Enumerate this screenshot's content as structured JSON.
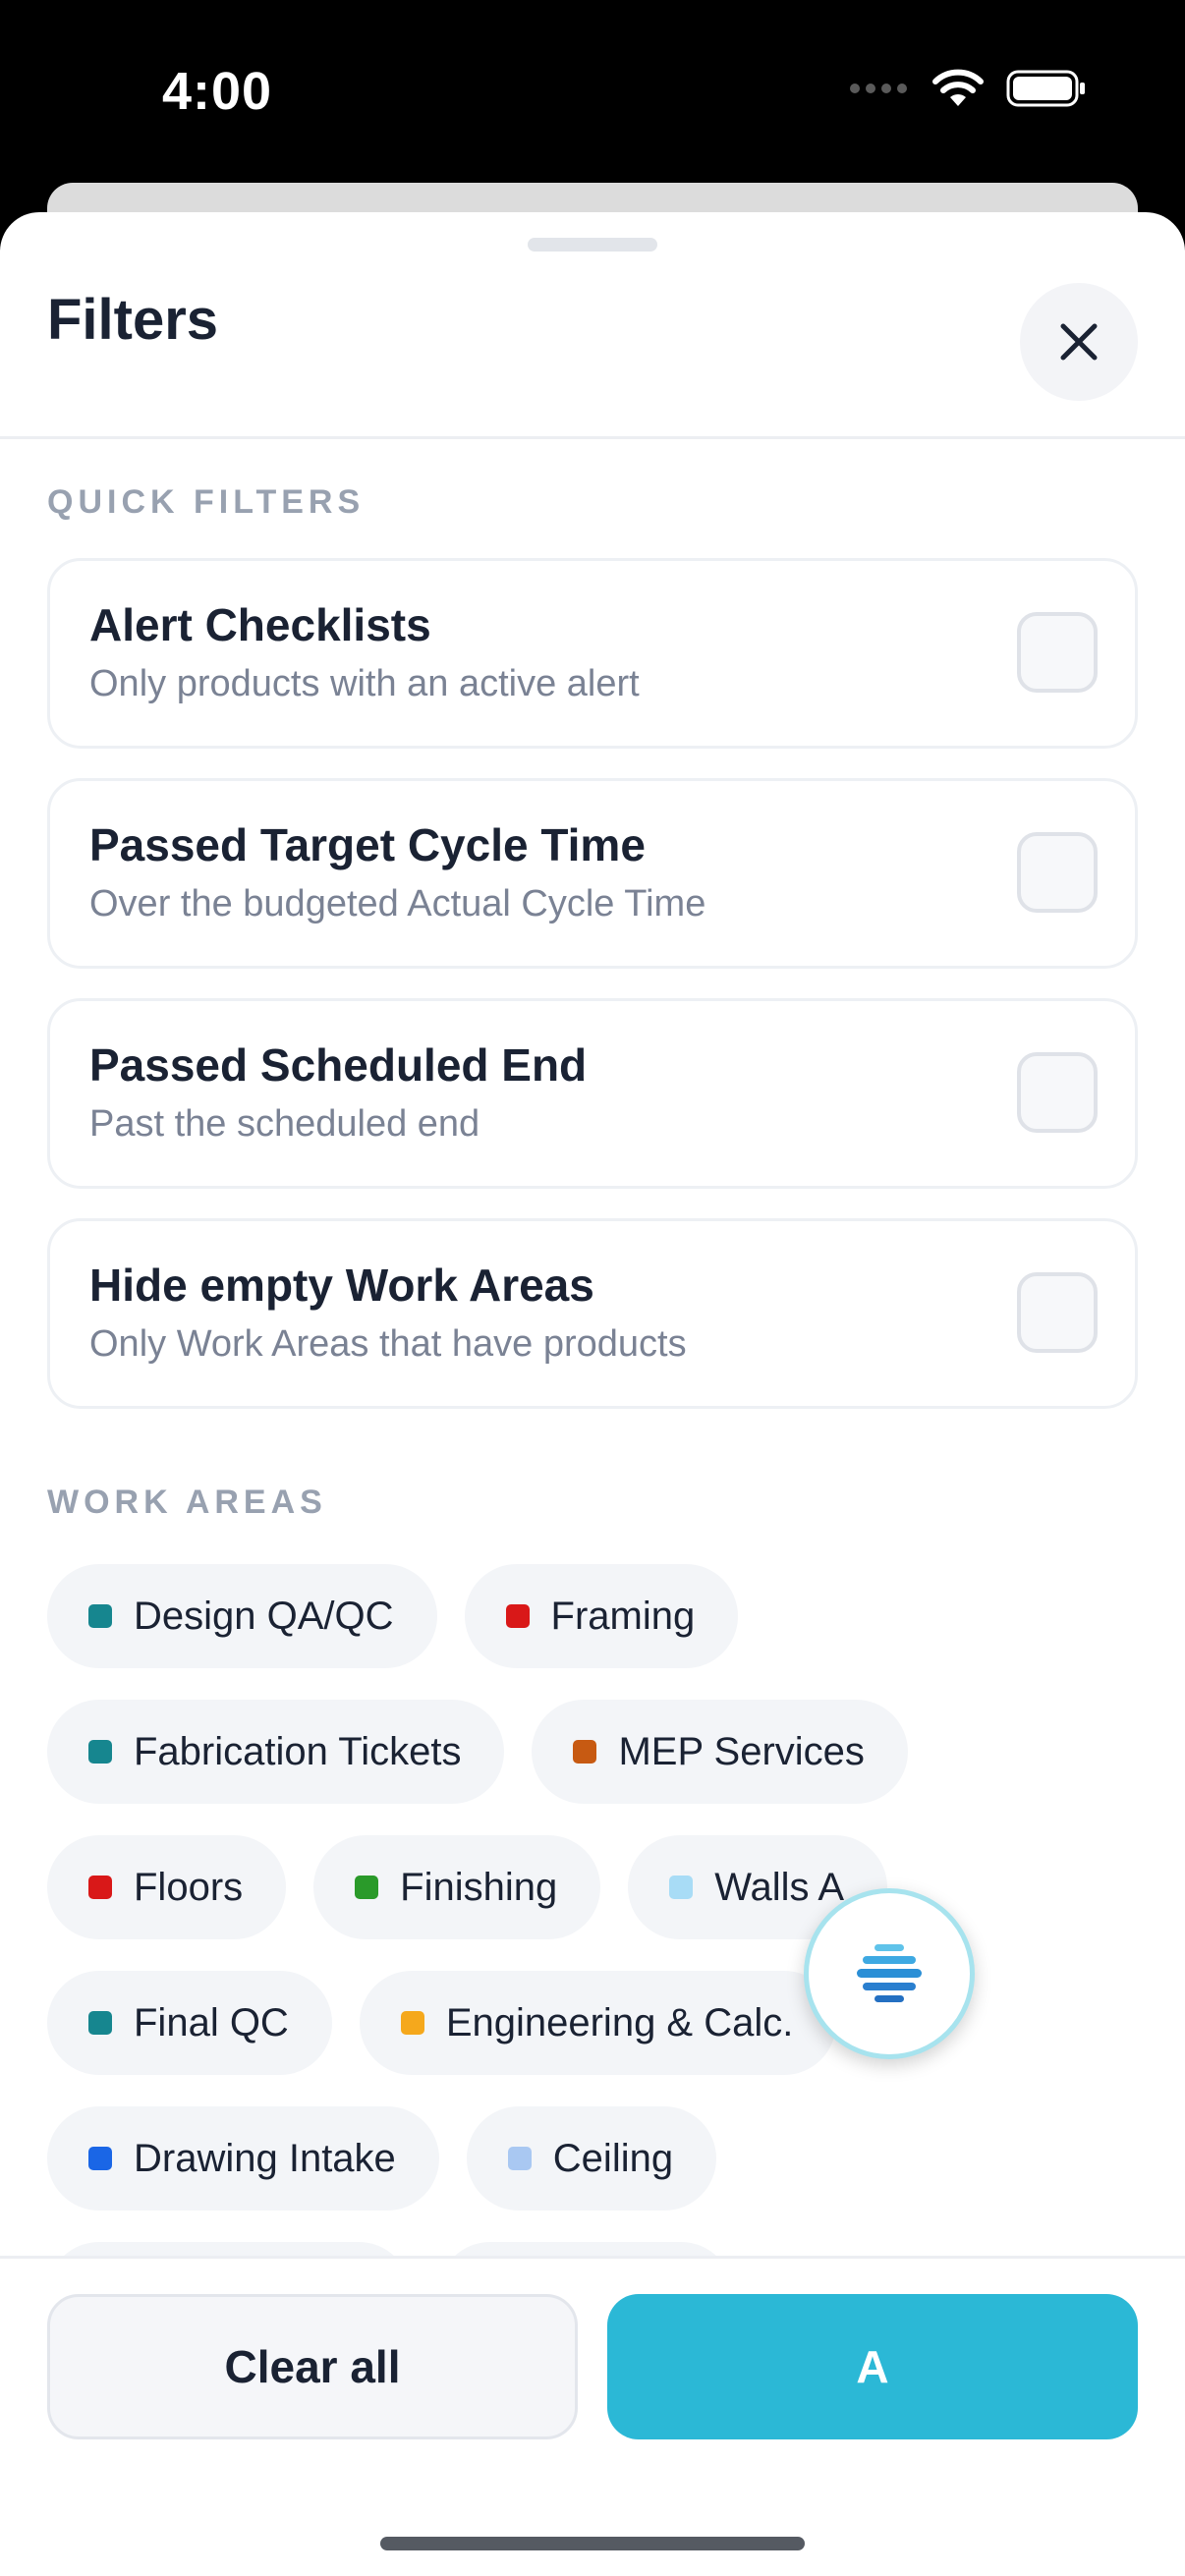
{
  "status_bar": {
    "time": "4:00"
  },
  "sheet": {
    "title": "Filters"
  },
  "quick_filters": {
    "label": "QUICK FILTERS",
    "items": [
      {
        "title": "Alert Checklists",
        "subtitle": "Only products with an active alert",
        "checked": false
      },
      {
        "title": "Passed Target Cycle Time",
        "subtitle": "Over the budgeted Actual Cycle Time",
        "checked": false
      },
      {
        "title": "Passed Scheduled End",
        "subtitle": "Past the scheduled end",
        "checked": false
      },
      {
        "title": "Hide empty Work Areas",
        "subtitle": "Only Work Areas that have products",
        "checked": false
      }
    ]
  },
  "work_areas": {
    "label": "WORK AREAS",
    "chips": [
      {
        "label": "Design QA/QC",
        "color": "#16868f"
      },
      {
        "label": "Framing",
        "color": "#d91818"
      },
      {
        "label": "Fabrication Tickets",
        "color": "#16868f"
      },
      {
        "label": "MEP Services",
        "color": "#c75a12"
      },
      {
        "label": "Floors",
        "color": "#d91818"
      },
      {
        "label": "Finishing",
        "color": "#2a9a2a"
      },
      {
        "label": "Walls A",
        "color": "#a8dcf6"
      },
      {
        "label": "Final QC",
        "color": "#16868f"
      },
      {
        "label": "Engineering & Calc.",
        "color": "#f5a81c"
      },
      {
        "label": "Drawing Intake",
        "color": "#1a66e6"
      },
      {
        "label": "Ceiling",
        "color": "#a9c8f2"
      }
    ]
  },
  "footer": {
    "clear_label": "Clear all",
    "apply_label": "A"
  },
  "icons": {
    "close": "close-icon",
    "fab": "assistant-logo-icon"
  }
}
